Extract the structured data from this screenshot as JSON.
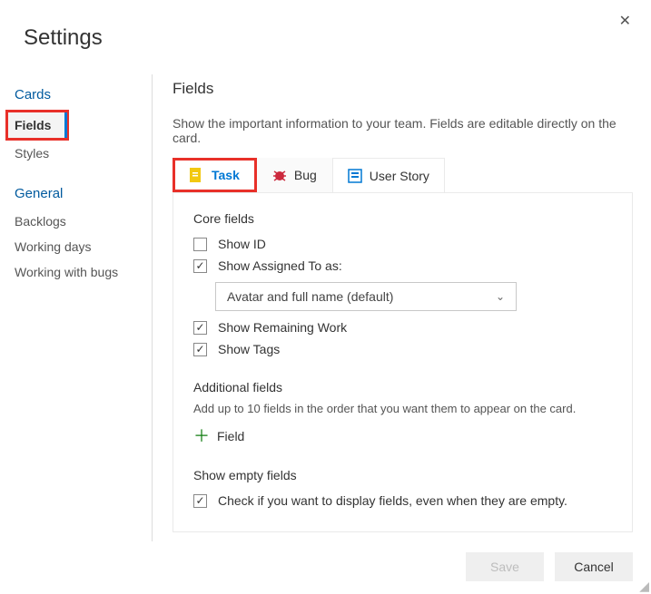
{
  "window": {
    "title": "Settings"
  },
  "sidebar": {
    "groups": [
      {
        "title": "Cards",
        "items": [
          {
            "label": "Fields",
            "active": true
          },
          {
            "label": "Styles",
            "active": false
          }
        ]
      },
      {
        "title": "General",
        "items": [
          {
            "label": "Backlogs",
            "active": false
          },
          {
            "label": "Working days",
            "active": false
          },
          {
            "label": "Working with bugs",
            "active": false
          }
        ]
      }
    ]
  },
  "main": {
    "title": "Fields",
    "help": "Show the important information to your team. Fields are editable directly on the card.",
    "tabs": [
      {
        "label": "Task",
        "icon": "task-icon",
        "active": true
      },
      {
        "label": "Bug",
        "icon": "bug-icon",
        "active": false
      },
      {
        "label": "User Story",
        "icon": "userstory-icon",
        "active": false
      }
    ],
    "core": {
      "title": "Core fields",
      "show_id": {
        "label": "Show ID",
        "checked": false
      },
      "assigned_to": {
        "label": "Show Assigned To as:",
        "checked": true,
        "selected": "Avatar and full name (default)"
      },
      "remaining_work": {
        "label": "Show Remaining Work",
        "checked": true
      },
      "tags": {
        "label": "Show Tags",
        "checked": true
      }
    },
    "additional": {
      "title": "Additional fields",
      "help": "Add up to 10 fields in the order that you want them to appear on the card.",
      "add_label": "Field"
    },
    "empty": {
      "title": "Show empty fields",
      "checkbox": {
        "label": "Check if you want to display fields, even when they are empty.",
        "checked": true
      }
    }
  },
  "footer": {
    "save": "Save",
    "cancel": "Cancel"
  }
}
